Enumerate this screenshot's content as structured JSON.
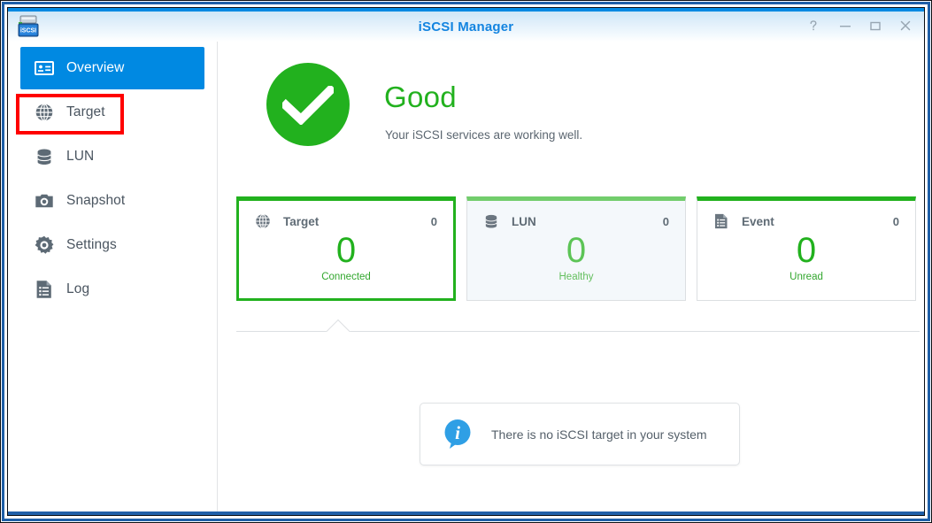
{
  "window": {
    "title": "iSCSI Manager",
    "app_icon": "iscsi-app-icon",
    "icon_label": "iSCSI",
    "controls": [
      {
        "name": "help",
        "glyph": "?"
      },
      {
        "name": "minimize",
        "glyph": "–"
      },
      {
        "name": "maximize",
        "glyph": "□"
      },
      {
        "name": "close",
        "glyph": "×"
      }
    ]
  },
  "sidebar": {
    "items": [
      {
        "id": "overview",
        "label": "Overview",
        "icon": "overview-card-icon",
        "active": true,
        "highlighted": false
      },
      {
        "id": "target",
        "label": "Target",
        "icon": "globe-icon",
        "active": false,
        "highlighted": true
      },
      {
        "id": "lun",
        "label": "LUN",
        "icon": "database-icon",
        "active": false,
        "highlighted": false
      },
      {
        "id": "snapshot",
        "label": "Snapshot",
        "icon": "camera-icon",
        "active": false,
        "highlighted": false
      },
      {
        "id": "settings",
        "label": "Settings",
        "icon": "gear-icon",
        "active": false,
        "highlighted": false
      },
      {
        "id": "log",
        "label": "Log",
        "icon": "document-list-icon",
        "active": false,
        "highlighted": false
      }
    ],
    "highlight_color": "#ff0000",
    "active_color": "#0089e2"
  },
  "status": {
    "icon": "check-circle-icon",
    "title": "Good",
    "description": "Your iSCSI services are working well.",
    "color": "#22b11e"
  },
  "cards": [
    {
      "id": "target",
      "icon": "globe-icon",
      "title": "Target",
      "count": "0",
      "value": "0",
      "sublabel": "Connected",
      "state": "selected"
    },
    {
      "id": "lun",
      "icon": "database-icon",
      "title": "LUN",
      "count": "0",
      "value": "0",
      "sublabel": "Healthy",
      "state": "hover"
    },
    {
      "id": "event",
      "icon": "document-list-icon",
      "title": "Event",
      "count": "0",
      "value": "0",
      "sublabel": "Unread",
      "state": "normal"
    }
  ],
  "info": {
    "icon": "info-bubble-icon",
    "message": "There is no iSCSI target in your system"
  }
}
